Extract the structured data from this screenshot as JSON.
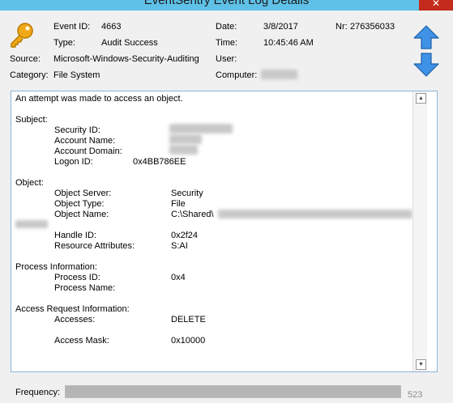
{
  "window": {
    "title": "EventSentry Event Log Details",
    "close_label": "✕"
  },
  "header": {
    "event_id_label": "Event ID:",
    "event_id": "4663",
    "date_label": "Date:",
    "date": "3/8/2017",
    "nr_label": "Nr:",
    "nr": "276356033",
    "type_label": "Type:",
    "type": "Audit Success",
    "time_label": "Time:",
    "time": "10:45:46 AM",
    "source_label": "Source:",
    "source": "Microsoft-Windows-Security-Auditing",
    "user_label": "User:",
    "category_label": "Category:",
    "category": "File System",
    "computer_label": "Computer:"
  },
  "icons": {
    "event_type": "key-icon",
    "previous": "arrow-up-icon",
    "next": "arrow-down-icon",
    "accent": "#2a7fd4",
    "key_color": "#f0a818"
  },
  "details": {
    "intro": "An attempt was made to access an object.",
    "subject_heading": "Subject:",
    "security_id_label": "Security ID:",
    "account_name_label": "Account Name:",
    "account_domain_label": "Account Domain:",
    "logon_id_label": "Logon ID:",
    "logon_id": "0x4BB786EE",
    "object_heading": "Object:",
    "object_server_label": "Object Server:",
    "object_server": "Security",
    "object_type_label": "Object Type:",
    "object_type": "File",
    "object_name_label": "Object Name:",
    "object_name": "C:\\Shared\\",
    "handle_id_label": "Handle ID:",
    "handle_id": "0x2f24",
    "resource_attributes_label": "Resource Attributes:",
    "resource_attributes": "S:AI",
    "process_heading": "Process Information:",
    "process_id_label": "Process ID:",
    "process_id": "0x4",
    "process_name_label": "Process Name:",
    "access_heading": "Access Request Information:",
    "accesses_label": "Accesses:",
    "accesses": "DELETE",
    "access_mask_label": "Access Mask:",
    "access_mask": "0x10000"
  },
  "frequency": {
    "label": "Frequency:",
    "count": "523",
    "fill_fraction": 1.0
  }
}
